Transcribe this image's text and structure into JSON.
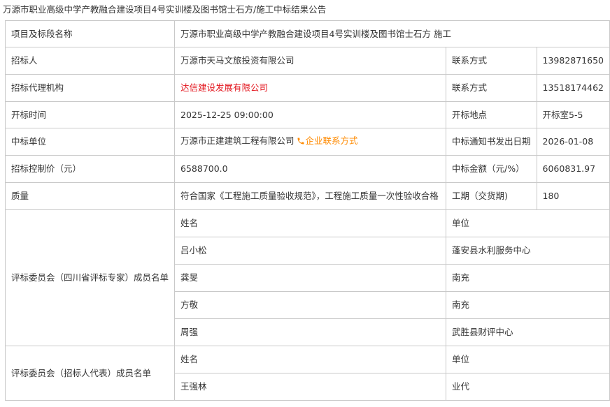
{
  "page_title": "万源市职业高级中学产教融合建设项目4号实训楼及图书馆士石方/施工中标结果公告",
  "rows": {
    "project": {
      "label": "项目及标段名称",
      "value": "万源市职业高级中学产教融合建设项目4号实训楼及图书馆士石方 施工"
    },
    "tenderer": {
      "label": "招标人",
      "value": "万源市天马文旅投资有限公司",
      "contact_label": "联系方式",
      "contact_value": "13982871650"
    },
    "agency": {
      "label": "招标代理机构",
      "value": "达信建设发展有限公司",
      "contact_label": "联系方式",
      "contact_value": "13518174462"
    },
    "open_time": {
      "label": "开标时间",
      "value": "2025-12-25 09:00:00",
      "place_label": "开标地点",
      "place_value": "开标室5-5"
    },
    "winner": {
      "label": "中标单位",
      "value": "万源市正建建筑工程有限公司",
      "link_text": "企业联系方式",
      "notice_label": "中标通知书发出日期",
      "notice_value": "2026-01-08"
    },
    "price": {
      "label": "招标控制价（元）",
      "value": "6588700.0",
      "amount_label": "中标金额（元/%）",
      "amount_value": "6060831.97"
    },
    "quality": {
      "label": "质量",
      "value": "符合国家《工程施工质量验收规范》，工程施工质量一次性验收合格",
      "period_label": "工期（交货期)",
      "period_value": "180"
    }
  },
  "committee_experts": {
    "label": "评标委员会（四川省评标专家）成员名单",
    "col_name": "姓名",
    "col_unit": "单位",
    "members": [
      {
        "name": "吕小松",
        "unit": "蓬安县水利服务中心"
      },
      {
        "name": "龚旻",
        "unit": "南充"
      },
      {
        "name": "方敬",
        "unit": "南充"
      },
      {
        "name": "周强",
        "unit": "武胜县财评中心"
      }
    ]
  },
  "committee_reps": {
    "label": "评标委员会（招标人代表）成员名单",
    "col_name": "姓名",
    "col_unit": "单位",
    "members": [
      {
        "name": "王强林",
        "unit": "业代"
      }
    ]
  },
  "colors": {
    "border": "#c9c9c9",
    "text": "#333333",
    "agency_red": "#e3141c",
    "link_orange": "#ff8a00"
  },
  "icons": {
    "phone": "phone-icon"
  }
}
